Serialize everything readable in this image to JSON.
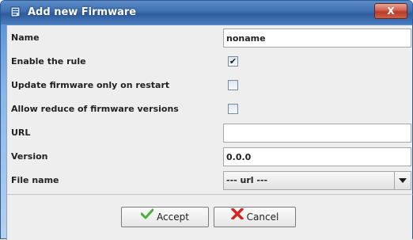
{
  "window": {
    "title": "Add new Firmware",
    "close_label": "X"
  },
  "form": {
    "name": {
      "label": "Name",
      "value": "noname"
    },
    "enable_rule": {
      "label": "Enable the rule",
      "checked": true,
      "mark": "✔"
    },
    "update_on_restart": {
      "label": "Update firmware only on restart",
      "checked": false
    },
    "allow_reduce": {
      "label": "Allow reduce of firmware versions",
      "checked": false
    },
    "url": {
      "label": "URL",
      "value": ""
    },
    "version": {
      "label": "Version",
      "value": "0.0.0"
    },
    "file_name": {
      "label": "File name",
      "selected": "--- url ---"
    }
  },
  "buttons": {
    "accept_label": "Accept",
    "cancel_label": "Cancel"
  },
  "colors": {
    "titlebar": "#3f6fb0",
    "content_bg": "#eeeeee",
    "accept_icon": "#4caf3a",
    "cancel_icon": "#d9231d"
  },
  "icons": {
    "title": "firmware-icon",
    "accept": "checkmark-icon",
    "cancel": "x-mark-icon",
    "select": "chevron-down-icon"
  }
}
